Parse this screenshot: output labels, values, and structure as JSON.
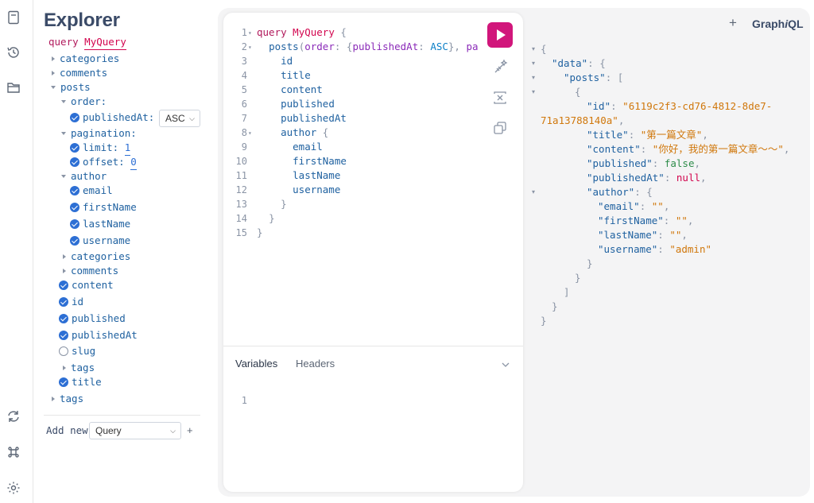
{
  "rail": {
    "icons": [
      "docs-icon",
      "history-icon",
      "explorer-folder-icon",
      "refetch-icon",
      "shortcuts-icon",
      "settings-icon"
    ]
  },
  "explorer": {
    "title": "Explorer",
    "operation_kw": "query",
    "operation_name": "MyQuery",
    "rows": {
      "categories": "categories",
      "comments": "comments",
      "posts": "posts",
      "order": "order:",
      "publishedAt_arg": "publishedAt:",
      "pagination": "pagination:",
      "limit": "limit:",
      "limit_val": "1",
      "offset": "offset:",
      "offset_val": "0",
      "author": "author",
      "email": "email",
      "firstName": "firstName",
      "lastName": "lastName",
      "username": "username",
      "author_categories": "categories",
      "author_comments": "comments",
      "content": "content",
      "id": "id",
      "published": "published",
      "publishedAt": "publishedAt",
      "slug": "slug",
      "posts_tags": "tags",
      "title": "title",
      "tags": "tags"
    },
    "order_select": "ASC",
    "add_new_label": "Add new",
    "add_new_select": "Query",
    "add_new_plus": "+"
  },
  "editor": {
    "lines": [
      "1",
      "2",
      "3",
      "4",
      "5",
      "6",
      "7",
      "8",
      "9",
      "10",
      "11",
      "12",
      "13",
      "14",
      "15"
    ],
    "tokens": {
      "l1_kw": "query",
      "l1_name": "MyQuery",
      "l1_p": " {",
      "l2_field": "posts",
      "l2_p1": "(",
      "l2_arg": "order",
      "l2_p2": ": {",
      "l2_arg2": "publishedAt",
      "l2_p3": ": ",
      "l2_enum": "ASC",
      "l2_p4": "}, ",
      "l2_arg3": "pag",
      "l3": "id",
      "l4": "title",
      "l5": "content",
      "l6": "published",
      "l7": "publishedAt",
      "l8_field": "author",
      "l8_p": " {",
      "l9": "email",
      "l10": "firstName",
      "l11": "lastName",
      "l12": "username",
      "l13": "}",
      "l14": "}",
      "l15": "}"
    },
    "variables_tab": "Variables",
    "headers_tab": "Headers",
    "variables_line": "1"
  },
  "header": {
    "plus": "+",
    "logo_a": "Graph",
    "logo_b": "i",
    "logo_c": "QL"
  },
  "result": {
    "open_brace": "{",
    "data_key": "\"data\"",
    "posts_key": "\"posts\"",
    "id_key": "\"id\"",
    "id_val_a": "\"6119c2f3-cd76-4812-8de7-",
    "id_val_b": "71a13788140a\"",
    "title_key": "\"title\"",
    "title_val": "\"第一篇文章\"",
    "content_key": "\"content\"",
    "content_val": "\"你好，我的第一篇文章～～\"",
    "published_key": "\"published\"",
    "published_val": "false",
    "publishedAt_key": "\"publishedAt\"",
    "publishedAt_val": "null",
    "author_key": "\"author\"",
    "email_key": "\"email\"",
    "email_val": "\"\"",
    "firstName_key": "\"firstName\"",
    "firstName_val": "\"\"",
    "lastName_key": "\"lastName\"",
    "lastName_val": "\"\"",
    "username_key": "\"username\"",
    "username_val": "\"admin\""
  },
  "colors": {
    "run_button": "#d1167b",
    "check_blue": "#2d6fd4",
    "keyword": "#b11a5c",
    "field": "#1f61a0",
    "string": "#d0770b"
  }
}
